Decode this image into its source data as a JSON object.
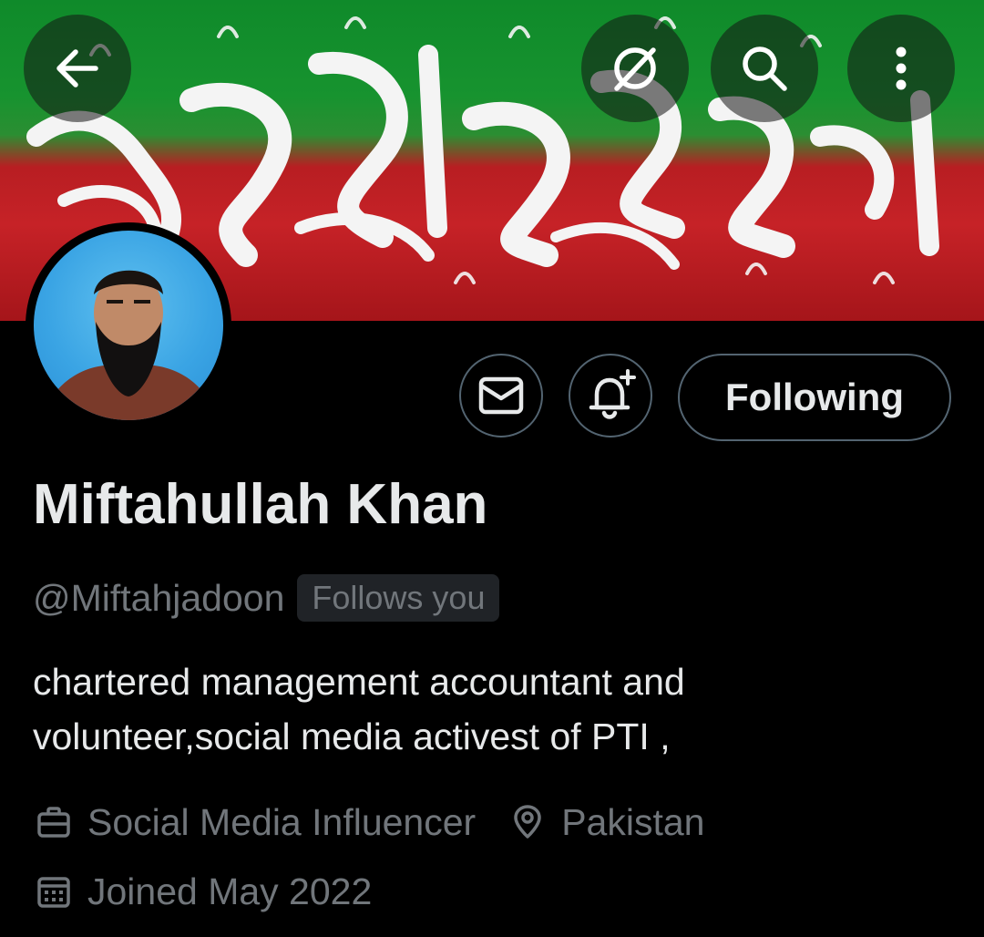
{
  "header": {
    "back_icon": "arrow-left-icon",
    "grok_icon": "grok-icon",
    "search_icon": "search-icon",
    "more_icon": "more-vertical-icon"
  },
  "banner": {
    "colors": [
      "#17932f",
      "#c62227"
    ]
  },
  "actions": {
    "message_icon": "envelope-icon",
    "notify_icon": "bell-plus-icon",
    "following_label": "Following"
  },
  "profile": {
    "name": "Miftahullah Khan",
    "handle": "@Miftahjadoon",
    "follows_you": "Follows you",
    "bio_lines": [
      "chartered management accountant and",
      "volunteer,social media activest of PTI ,"
    ],
    "occupation": "Social Media Influencer",
    "location": "Pakistan",
    "joined": "Joined May 2022"
  },
  "colors": {
    "background": "#000000",
    "primary_text": "#e7e9ea",
    "secondary_text": "#71767b",
    "border": "#536471"
  }
}
